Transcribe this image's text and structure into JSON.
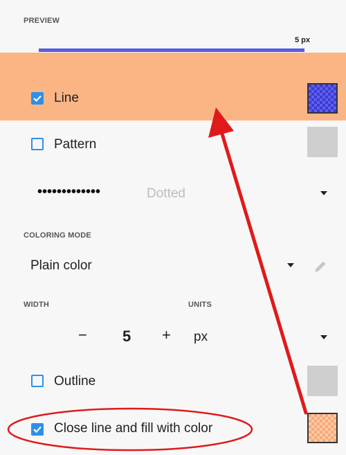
{
  "preview": {
    "label": "PREVIEW",
    "value": "5 px"
  },
  "line_row": {
    "label": "Line",
    "checked": true
  },
  "pattern_row": {
    "label": "Pattern",
    "checked": false
  },
  "pattern_select": {
    "sample": "•••••••••••••",
    "value": "Dotted"
  },
  "coloring": {
    "label": "COLORING MODE",
    "value": "Plain color"
  },
  "width": {
    "label": "WIDTH",
    "minus": "−",
    "value": "5",
    "plus": "+"
  },
  "units": {
    "label": "UNITS",
    "value": "px"
  },
  "outline_row": {
    "label": "Outline",
    "checked": false
  },
  "fill_row": {
    "label": "Close line and fill with color",
    "checked": true
  },
  "colors": {
    "accent": "#2f8fe8",
    "highlight": "#fbb584",
    "annotation": "#e01a1a",
    "line_color": "#5a5ae0",
    "fill_color": "#f7a978"
  }
}
